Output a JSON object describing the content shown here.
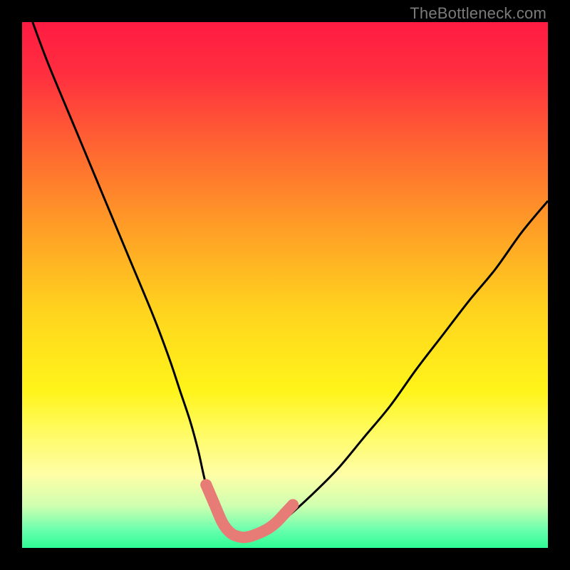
{
  "watermark": "TheBottleneck.com",
  "colors": {
    "gradient_stops": [
      {
        "offset": 0.0,
        "color": "#ff1b42"
      },
      {
        "offset": 0.1,
        "color": "#ff2f3f"
      },
      {
        "offset": 0.25,
        "color": "#ff6a30"
      },
      {
        "offset": 0.4,
        "color": "#ffa126"
      },
      {
        "offset": 0.55,
        "color": "#ffd41e"
      },
      {
        "offset": 0.7,
        "color": "#fff41a"
      },
      {
        "offset": 0.78,
        "color": "#fffb62"
      },
      {
        "offset": 0.86,
        "color": "#fffea6"
      },
      {
        "offset": 0.92,
        "color": "#cfffb0"
      },
      {
        "offset": 0.965,
        "color": "#6bffad"
      },
      {
        "offset": 1.0,
        "color": "#2dfc94"
      }
    ],
    "curve": "#000000",
    "marker": "#e77b76",
    "frame": "#000000"
  },
  "chart_data": {
    "type": "line",
    "title": "",
    "xlabel": "",
    "ylabel": "",
    "xlim": [
      0,
      100
    ],
    "ylim": [
      0,
      100
    ],
    "grid": false,
    "series": [
      {
        "name": "bottleneck-curve",
        "x": [
          2,
          5,
          10,
          15,
          20,
          25,
          28,
          30,
          32,
          33.5,
          35,
          37,
          39,
          41,
          43,
          45,
          47,
          50,
          55,
          60,
          65,
          70,
          75,
          80,
          85,
          90,
          95,
          100
        ],
        "y": [
          100,
          92,
          80,
          68,
          56,
          44,
          36,
          30,
          24,
          18.5,
          12,
          6.5,
          3.5,
          2.2,
          2,
          2.2,
          3.2,
          5.5,
          10,
          15,
          21,
          27,
          34,
          40.5,
          47,
          53,
          60,
          66
        ]
      }
    ],
    "markers": {
      "name": "highlight-range",
      "x": [
        35,
        36.5,
        38,
        39,
        40,
        41,
        42,
        43,
        44,
        45.5,
        47,
        48.5,
        50,
        51.5
      ],
      "y": [
        12,
        8.5,
        5,
        3.5,
        2.6,
        2.2,
        2,
        2.1,
        2.4,
        3.0,
        3.8,
        5.0,
        6.6,
        8.2
      ]
    }
  }
}
